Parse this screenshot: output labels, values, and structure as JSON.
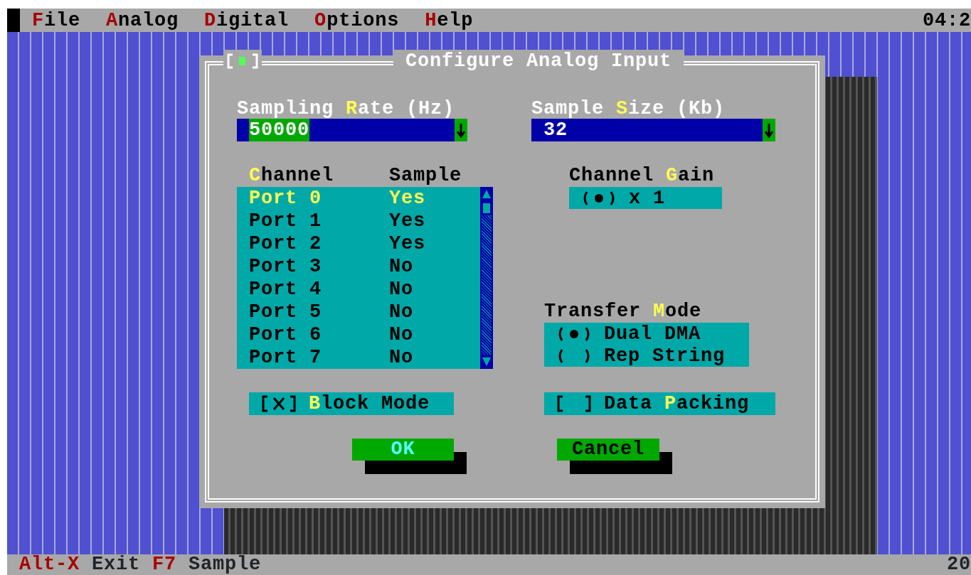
{
  "menu_bar": {
    "items": [
      {
        "label": "**F**ile"
      },
      {
        "label": "**A**nalog"
      },
      {
        "label": "**D**igital"
      },
      {
        "label": "**O**ptions"
      },
      {
        "label": "**H**elp"
      }
    ],
    "clock": "04:2"
  },
  "dialog": {
    "title": "Configure Analog Input",
    "sampling_rate": {
      "label": "Sampling **R**ate (Hz)",
      "value": "50000",
      "focused": true
    },
    "sample_size": {
      "label": "Sample **S**ize (Kb)",
      "value": "32",
      "focused": false
    },
    "channel_list": {
      "columns": [
        "**C**hannel",
        "Sample"
      ],
      "rows": [
        {
          "channel": "Port 0",
          "sample": "Yes",
          "selected": true
        },
        {
          "channel": "Port 1",
          "sample": "Yes",
          "selected": false
        },
        {
          "channel": "Port 2",
          "sample": "Yes",
          "selected": false
        },
        {
          "channel": "Port 3",
          "sample": "No",
          "selected": false
        },
        {
          "channel": "Port 4",
          "sample": "No",
          "selected": false
        },
        {
          "channel": "Port 5",
          "sample": "No",
          "selected": false
        },
        {
          "channel": "Port 6",
          "sample": "No",
          "selected": false
        },
        {
          "channel": "Port 7",
          "sample": "No",
          "selected": false
        }
      ]
    },
    "channel_gain": {
      "label": "Channel **G**ain",
      "options": [
        {
          "label": "x 1",
          "selected": true
        }
      ]
    },
    "transfer_mode": {
      "label": "Transfer **M**ode",
      "options": [
        {
          "label": "Dual DMA",
          "selected": true
        },
        {
          "label": "Rep String",
          "selected": false
        }
      ]
    },
    "block_mode": {
      "label": "**B**lock Mode",
      "checked": true
    },
    "data_packing": {
      "label": "Data **P**acking",
      "checked": false
    },
    "buttons": [
      {
        "label": "OK",
        "default": true
      },
      {
        "label": "Cancel",
        "default": false
      }
    ]
  },
  "status_bar": {
    "items": [
      {
        "key": "Alt-X",
        "label": "Exit"
      },
      {
        "key": "F7",
        "label": "Sample"
      }
    ],
    "right_text": "20"
  }
}
